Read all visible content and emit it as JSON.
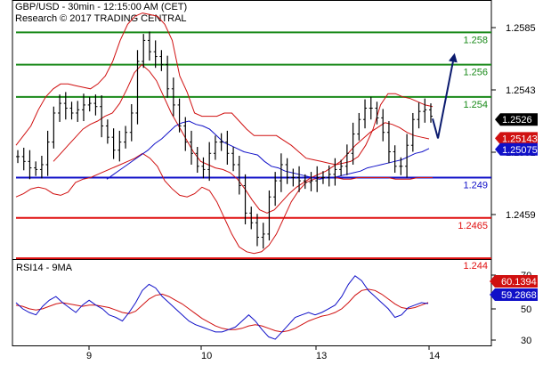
{
  "header": {
    "line1": "GBP/USD - 30min - 12:15:00 AM (CET)",
    "line2": "Research © 2017 TRADING CENTRAL"
  },
  "chart_data": [
    {
      "type": "candlestick",
      "ylim": [
        2.4395,
        2.5995
      ],
      "y_ticks": [
        "1.2585",
        "1.2543",
        "1.2501",
        "1.2459"
      ],
      "x_ticks": [
        "9",
        "10",
        "13",
        "14"
      ],
      "levels": [
        {
          "label": "1.258",
          "value": 2.58,
          "color": "#1a8a1a"
        },
        {
          "label": "1.256",
          "value": 2.56,
          "color": "#1a8a1a"
        },
        {
          "label": "1.254",
          "value": 2.54,
          "color": "#1a8a1a"
        },
        {
          "label": "1.249",
          "value": 2.49,
          "color": "#1010c8"
        },
        {
          "label": "1.2465",
          "value": 2.465,
          "color": "#e01010"
        },
        {
          "label": "1.244",
          "value": 2.44,
          "color": "#e01010"
        }
      ],
      "tags": [
        {
          "label": "1.2526",
          "value": 2.526,
          "color": "#000000"
        },
        {
          "label": "1.25143",
          "value": 2.5143,
          "color": "#d01010"
        },
        {
          "label": "1.25075",
          "value": 2.5075,
          "color": "#1010c8"
        }
      ],
      "price_close": [
        2.503,
        2.5,
        2.496,
        2.495,
        2.498,
        2.512,
        2.53,
        2.536,
        2.533,
        2.53,
        2.532,
        2.535,
        2.536,
        2.534,
        2.522,
        2.515,
        2.507,
        2.512,
        2.518,
        2.53,
        2.562,
        2.575,
        2.568,
        2.565,
        2.56,
        2.545,
        2.535,
        2.522,
        2.512,
        2.505,
        2.497,
        2.495,
        2.505,
        2.512,
        2.512,
        2.505,
        2.498,
        2.485,
        2.468,
        2.462,
        2.453,
        2.455,
        2.478,
        2.488,
        2.498,
        2.49,
        2.49,
        2.488,
        2.487,
        2.488,
        2.49,
        2.49,
        2.492,
        2.495,
        2.497,
        2.505,
        2.517,
        2.526,
        2.533,
        2.533,
        2.527,
        2.518,
        2.506,
        2.497,
        2.497,
        2.51,
        2.526,
        2.531,
        2.532,
        2.528
      ],
      "bb_upper": [
        2.51,
        2.516,
        2.522,
        2.532,
        2.54,
        2.545,
        2.548,
        2.548,
        2.547,
        2.546,
        2.545,
        2.548,
        2.553,
        2.562,
        2.575,
        2.585,
        2.59,
        2.592,
        2.591,
        2.59,
        2.585,
        2.575,
        2.553,
        2.543,
        2.53,
        2.528,
        2.528,
        2.528,
        2.53,
        2.53,
        2.525,
        2.52,
        2.516,
        2.516,
        2.516,
        2.516,
        2.513,
        2.51,
        2.506,
        2.502,
        2.501,
        2.5,
        2.499,
        2.498,
        2.499,
        2.5,
        2.503,
        2.51,
        2.52,
        2.535,
        2.542,
        2.542,
        2.54,
        2.539,
        2.537,
        2.535,
        2.534
      ],
      "bb_lower": [
        2.478,
        2.48,
        2.483,
        2.484,
        2.483,
        2.48,
        2.479,
        2.481,
        2.487,
        2.489,
        2.49,
        2.492,
        2.494,
        2.496,
        2.498,
        2.5,
        2.502,
        2.505,
        2.502,
        2.497,
        2.488,
        2.483,
        2.479,
        2.478,
        2.48,
        2.484,
        2.482,
        2.475,
        2.465,
        2.455,
        2.447,
        2.444,
        2.443,
        2.444,
        2.448,
        2.455,
        2.465,
        2.475,
        2.482,
        2.487,
        2.489,
        2.49,
        2.49,
        2.49,
        2.489,
        2.489,
        2.49,
        2.49,
        2.49,
        2.49,
        2.49,
        2.489,
        2.489,
        2.489,
        2.49,
        2.49,
        2.49
      ],
      "ma_blue": [
        2.489,
        2.492,
        2.495,
        2.498,
        2.501,
        2.504,
        2.507,
        2.511,
        2.514,
        2.518,
        2.522,
        2.524,
        2.525,
        2.523,
        2.522,
        2.52,
        2.516,
        2.512,
        2.51,
        2.508,
        2.506,
        2.505,
        2.504,
        2.5,
        2.497,
        2.496,
        2.494,
        2.493,
        2.492,
        2.491,
        2.49,
        2.489,
        2.49,
        2.49,
        2.491,
        2.492,
        2.493,
        2.494,
        2.496,
        2.497,
        2.498,
        2.499,
        2.5,
        2.501,
        2.503,
        2.505,
        2.506,
        2.508
      ],
      "ma_red": [
        2.5,
        2.505,
        2.51,
        2.515,
        2.52,
        2.523,
        2.525,
        2.528,
        2.53,
        2.536,
        2.545,
        2.555,
        2.56,
        2.556,
        2.55,
        2.54,
        2.53,
        2.522,
        2.514,
        2.506,
        2.5,
        2.498,
        2.496,
        2.495,
        2.493,
        2.489,
        2.483,
        2.476,
        2.47,
        2.468,
        2.47,
        2.475,
        2.48,
        2.484,
        2.487,
        2.49,
        2.492,
        2.494,
        2.497,
        2.5,
        2.505,
        2.51,
        2.514,
        2.518,
        2.521,
        2.524,
        2.523,
        2.521,
        2.518,
        2.516,
        2.515,
        2.514
      ],
      "forecast_arrow": [
        [
          2.514,
          2.5143
        ],
        [
          2.56,
          2.565
        ]
      ]
    },
    {
      "type": "line",
      "title": "RSI14 - 9MA",
      "ylim": [
        25,
        95
      ],
      "y_ticks": [
        "70",
        "50",
        "30"
      ],
      "tags": [
        {
          "label": "60.1394",
          "value": 60.1394,
          "color": "#d01010"
        },
        {
          "label": "59.2868",
          "value": 59.2868,
          "color": "#1010c8"
        }
      ],
      "series": [
        {
          "color": "#1010c8",
          "values": [
            60,
            55,
            52,
            50,
            57,
            62,
            65,
            60,
            56,
            52,
            58,
            62,
            58,
            55,
            50,
            48,
            45,
            52,
            60,
            70,
            75,
            72,
            65,
            60,
            55,
            50,
            45,
            42,
            40,
            38,
            36,
            36,
            38,
            40,
            45,
            50,
            45,
            38,
            32,
            30,
            36,
            42,
            48,
            50,
            52,
            50,
            52,
            55,
            58,
            65,
            75,
            82,
            78,
            70,
            65,
            60,
            55,
            48,
            50,
            56,
            58,
            60,
            59.3
          ]
        },
        {
          "color": "#d01010",
          "values": [
            58,
            57,
            55,
            54,
            55,
            57,
            59,
            60,
            59,
            58,
            57,
            58,
            58,
            57,
            56,
            54,
            52,
            51,
            53,
            58,
            63,
            66,
            67,
            65,
            62,
            59,
            55,
            51,
            47,
            44,
            41,
            39,
            38,
            38,
            39,
            41,
            42,
            41,
            39,
            37,
            36,
            37,
            39,
            42,
            45,
            47,
            49,
            50,
            52,
            55,
            60,
            66,
            70,
            71,
            70,
            67,
            63,
            59,
            56,
            55,
            56,
            58,
            60.1
          ]
        }
      ]
    }
  ]
}
